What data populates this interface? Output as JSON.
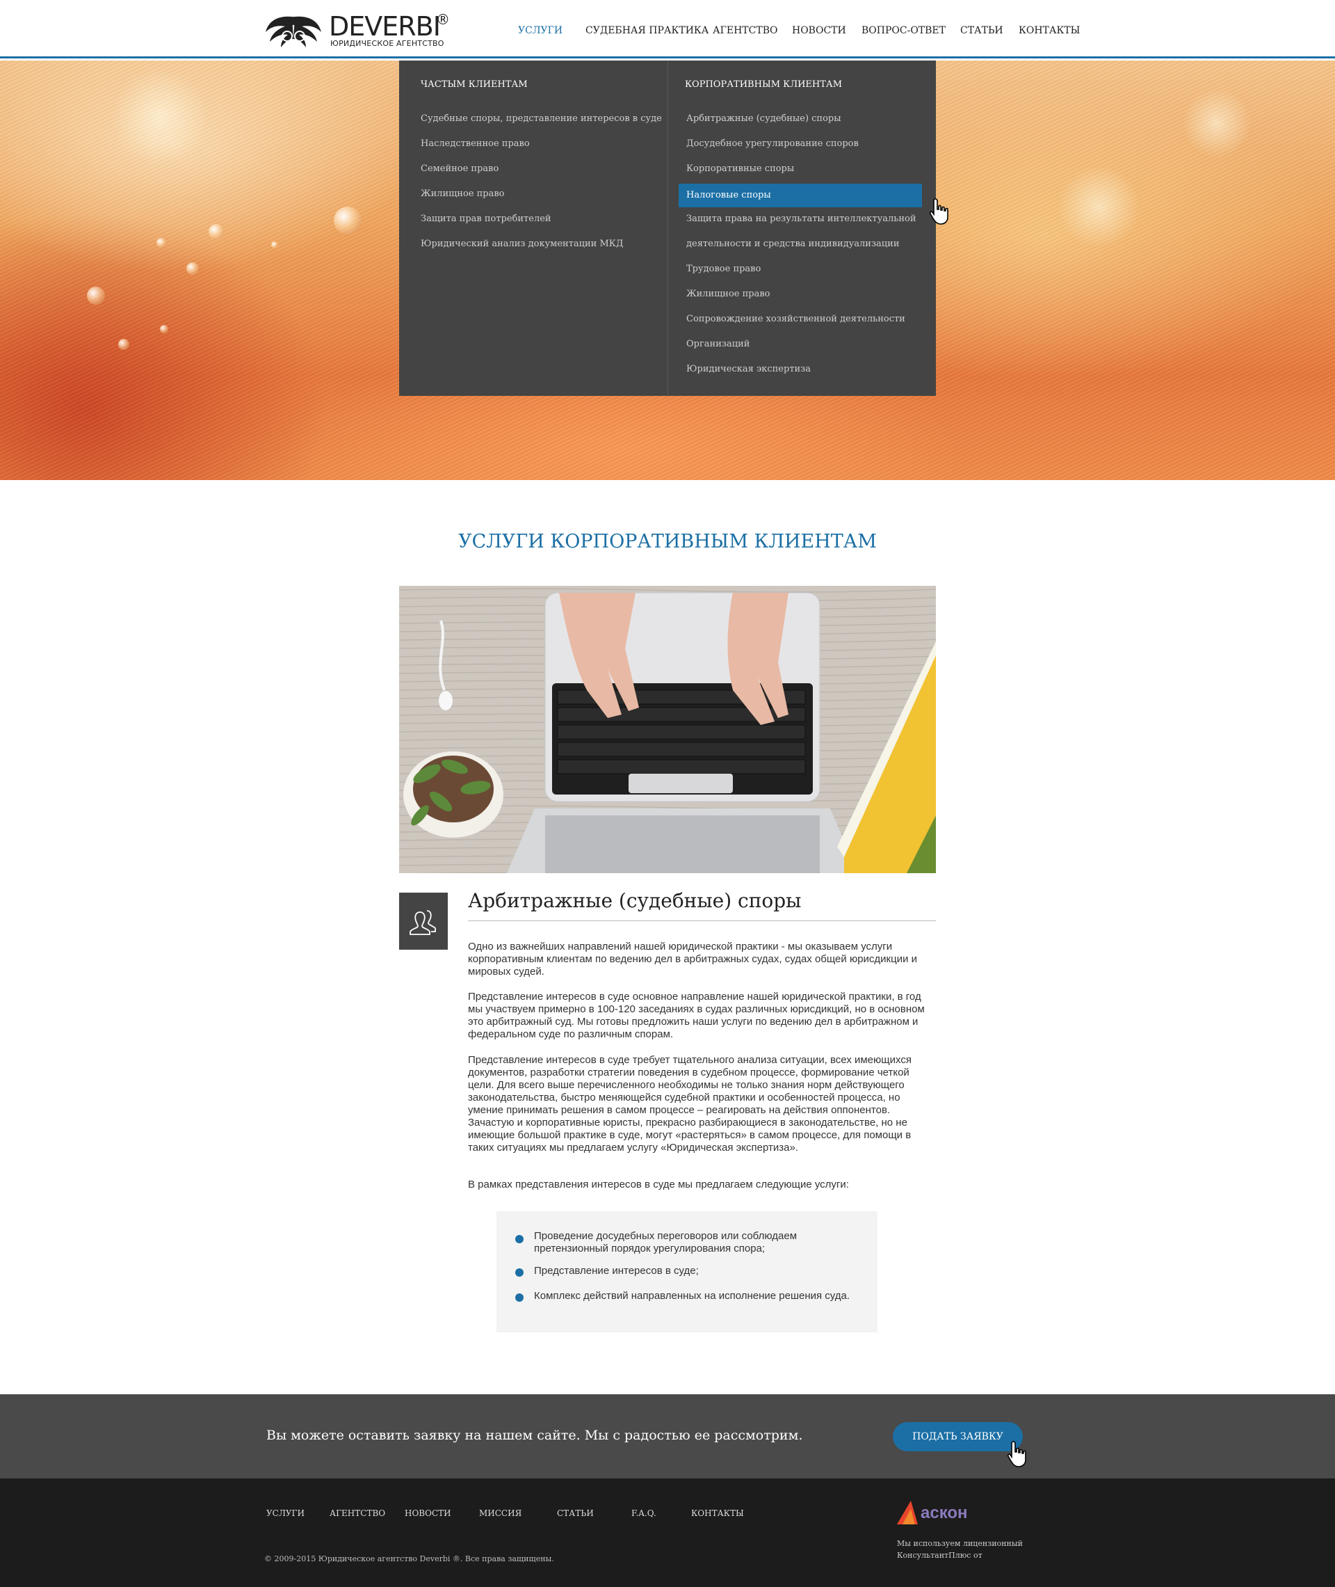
{
  "header": {
    "logo": {
      "name": "DEVERBI",
      "reg": "®",
      "subtitle": "ЮРИДИЧЕСКОЕ АГЕНТСТВО"
    },
    "nav": [
      "УСЛУГИ",
      "СУДЕБНАЯ ПРАКТИКА",
      "АГЕНТСТВО",
      "НОВОСТИ",
      "ВОПРОС-ОТВЕТ",
      "СТАТЬИ",
      "КОНТАКТЫ"
    ],
    "active_nav": "УСЛУГИ"
  },
  "dropdown": {
    "left_heading": "ЧАСТЫМ КЛИЕНТАМ",
    "left_items": [
      "Судебные споры, представление интересов в суде",
      "Наследственное право",
      "Семейное право",
      "Жилищное право",
      "Защита прав потребителей",
      "Юридический анализ документации МКД"
    ],
    "right_heading": "КОРПОРАТИВНЫМ КЛИЕНТАМ",
    "right_items": [
      "Арбитражные (судебные) споры",
      "Досудебное урегулирование споров",
      "Корпоративные споры",
      "Налоговые споры",
      "Защита права на результаты интеллектуальной",
      "деятельности и средства индивидуализации",
      "Трудовое право",
      "Жилищное право",
      "Сопровождение хозяйственной деятельности",
      "Организаций",
      "Юридическая экспертиза"
    ],
    "highlighted_item": "Налоговые споры"
  },
  "section": {
    "title": "УСЛУГИ КОРПОРАТИВНЫМ КЛИЕНТАМ"
  },
  "article": {
    "icon": "users-icon",
    "title": "Арбитражные (судебные) споры",
    "paragraphs": [
      "Одно из важнейших направлений нашей юридической практики - мы оказываем услуги корпоративным клиентам по ведению дел в арбитражных судах, судах общей юрисдикции и мировых судей.",
      "Представление интересов в суде основное направление нашей юридической практики, в год мы участвуем примерно в 100-120 заседаниях в судах различных юрисдикций, но в основном это арбитражный суд. Мы готовы предложить наши услуги по ведению дел в арбитражном и федеральном суде по различным спорам.",
      "Представление интересов в суде требует тщательного анализа ситуации, всех имеющихся документов, разработки стратегии поведения в судебном процессе, формирование четкой цели. Для всего выше перечисленного необходимы не только знания норм действующего законодательства, быстро меняющейся судебной практики и особенностей процесса, но умение принимать решения в самом процессе – реагировать на действия оппонентов. Зачастую и корпоративные юристы, прекрасно разбирающиеся в законодательстве, но не имеющие большой практике в суде, могут «растеряться» в самом процессе, для помощи в таких ситуациях мы предлагаем услугу «Юридическая экспертиза».",
      "В рамках представления интересов в суде мы предлагаем следующие услуги:"
    ],
    "list": [
      "Проведение досудебных переговоров или соблюдаем претензионный порядок урегулирования спора;",
      "Представление интересов в суде;",
      "Комплекс действий направленных на исполнение решения суда."
    ]
  },
  "cta": {
    "text": "Вы можете оставить заявку на нашем сайте. Мы с радостью ее рассмотрим.",
    "button": "ПОДАТЬ ЗАЯВКУ"
  },
  "footer": {
    "nav": [
      "УСЛУГИ",
      "АГЕНТСТВО",
      "НОВОСТИ",
      "МИССИЯ",
      "СТАТЬИ",
      "F.A.Q.",
      "КОНТАКТЫ"
    ],
    "copyright": "© 2009-2015 Юридическое агентство Deverbi ®. Все права защищены.",
    "partner_logo": "аскон",
    "partner_note": "Мы используем лицензионный КонсультантПлюс от"
  },
  "colors": {
    "accent": "#1b6fa5",
    "dark_panel": "#444444",
    "cta_bg": "#4a4a4a",
    "footer_bg": "#1c1c1c"
  }
}
